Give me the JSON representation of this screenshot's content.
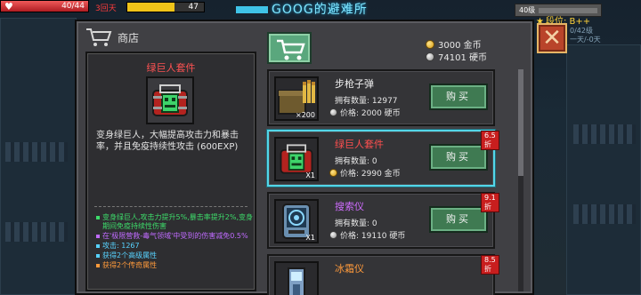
{
  "hud": {
    "hp_text": "40/44",
    "hp_fraction": 1.0,
    "status_text": "3回天",
    "xp_text": "47",
    "xp_fraction": 0.62,
    "title": "GOOG的避难所",
    "level": "40级",
    "rank": "段位: B++",
    "rank_detail": "0/42级\n一天/-0天",
    "colors": {
      "hp": "#d8323a",
      "xp": "#f0c419",
      "title": "#7fe6ff"
    }
  },
  "shop": {
    "header": "商店",
    "currency": {
      "gold": "3000 金币",
      "silver": "74101 硬币"
    }
  },
  "detail": {
    "name": "绿巨人套件",
    "description": "变身绿巨人，大幅提高攻击力和暴击率，并且免疫持续性攻击 (600EXP)",
    "effects": [
      {
        "text": "变身绿巨人,攻击力提升5%,暴击率提升2%,变身期间免疫持续性伤害",
        "color": "green"
      },
      {
        "text": "在'极限营救-毒气领域'中受到的伤害减免0.5%",
        "color": "purple"
      },
      {
        "text": "攻击: 1267",
        "color": "cyan"
      },
      {
        "text": "获得2个高级属性",
        "color": "cyan"
      },
      {
        "text": "获得2个传奇属性",
        "color": "orange"
      }
    ]
  },
  "items": [
    {
      "name": "步枪子弹",
      "owned": "拥有数量: 12977",
      "price": "价格: 2000 硬币",
      "currency": "silver",
      "buy": "购买",
      "badge": "",
      "count": "×200",
      "name_color": "white",
      "icon": "ammo-crate-icon"
    },
    {
      "name": "绿巨人套件",
      "owned": "拥有数量: 0",
      "price": "价格: 2990 金币",
      "currency": "gold",
      "buy": "购买",
      "badge": "6.5折",
      "count": "X1",
      "name_color": "red",
      "icon": "hulk-kit-icon",
      "selected": true
    },
    {
      "name": "搜索仪",
      "owned": "拥有数量: 0",
      "price": "价格: 19110 硬币",
      "currency": "silver",
      "buy": "购买",
      "badge": "9.1折",
      "count": "X1",
      "name_color": "purple",
      "icon": "scanner-icon"
    },
    {
      "name": "冰霜仪",
      "owned": "",
      "price": "",
      "currency": "silver",
      "buy": "",
      "badge": "8.5折",
      "count": "",
      "name_color": "orange",
      "icon": "frost-device-icon"
    }
  ]
}
